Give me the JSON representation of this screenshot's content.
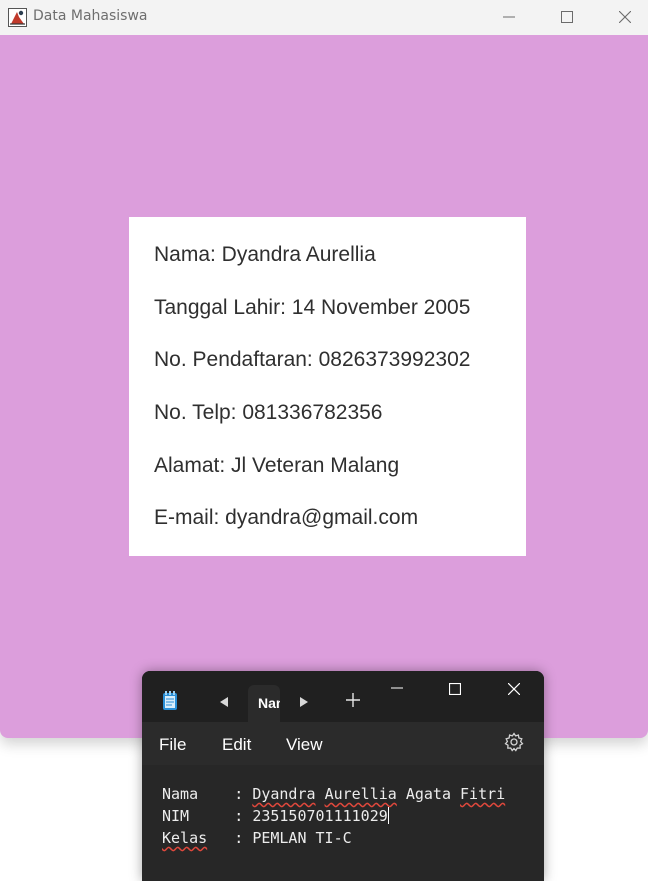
{
  "window": {
    "title": "Data Mahasiswa",
    "background_color": "#dc9edc",
    "controls": {
      "minimize_icon": "minimize-icon",
      "maximize_icon": "maximize-icon",
      "close_icon": "close-icon"
    }
  },
  "info_card": {
    "nama": "Nama: Dyandra Aurellia",
    "tanggal_lahir": "Tanggal Lahir: 14 November 2005",
    "no_pendaftaran": "No. Pendaftaran: 0826373992302",
    "no_telp": "No. Telp: 081336782356",
    "alamat": "Alamat: Jl Veteran Malang",
    "email": "E-mail: dyandra@gmail.com"
  },
  "notepad": {
    "tab_label": "Nama",
    "menu": {
      "file": "File",
      "edit": "Edit",
      "view": "View"
    },
    "lines": {
      "line1_label": "Nama",
      "line1_sep": "    : ",
      "line1_word1": "Dyandra",
      "line1_word2": "Aurellia",
      "line1_rest": " Agata ",
      "line1_word3": "Fitri",
      "line2_label": "NIM",
      "line2_sep": "     : ",
      "line2_value": "235150701111029",
      "line3_label": "Kelas",
      "line3_sep": "   : ",
      "line3_value": "PEMLAN TI-C"
    }
  }
}
